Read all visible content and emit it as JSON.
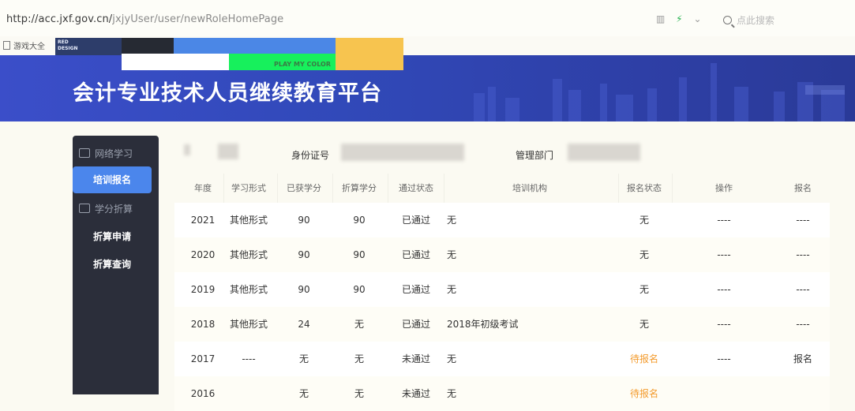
{
  "browser": {
    "url_host": "http://acc.jxf.gov.cn/",
    "url_path": "jxjyUser/user/newRoleHomePage",
    "search_placeholder": "点此搜索",
    "bookmark_label": "游戏大全"
  },
  "overlay": {
    "red_design_line1": "RED",
    "red_design_line2": "DESIGN",
    "play_label": "PLAY MY COLOR"
  },
  "banner": {
    "title": "会计专业技术人员继续教育平台"
  },
  "sidebar": {
    "group1": "网络学习",
    "active_item": "培训报名",
    "group2": "学分折算",
    "item1": "折算申请",
    "item2": "折算查询"
  },
  "info": {
    "id_label": "身份证号",
    "dept_label": "管理部门"
  },
  "table": {
    "headers": [
      "年度",
      "学习形式",
      "已获学分",
      "折算学分",
      "通过状态",
      "培训机构",
      "报名状态",
      "操作",
      "报名"
    ],
    "rows": [
      [
        "2021",
        "其他形式",
        "90",
        "90",
        "已通过",
        "无",
        "无",
        "----",
        "----"
      ],
      [
        "2020",
        "其他形式",
        "90",
        "90",
        "已通过",
        "无",
        "无",
        "----",
        "----"
      ],
      [
        "2019",
        "其他形式",
        "90",
        "90",
        "已通过",
        "无",
        "无",
        "----",
        "----"
      ],
      [
        "2018",
        "其他形式",
        "24",
        "无",
        "已通过",
        "2018年初级考试",
        "无",
        "----",
        "----"
      ],
      [
        "2017",
        "----",
        "无",
        "无",
        "未通过",
        "无",
        "待报名",
        "----",
        "报名"
      ],
      [
        "2016",
        "",
        "无",
        "无",
        "未通过",
        "无",
        "待报名",
        "",
        ""
      ]
    ]
  },
  "colors": {
    "accent": "#4b86ec",
    "sidebar_bg": "#2b2e3a",
    "banner": "#3149b9",
    "pending": "#f39a2b"
  }
}
